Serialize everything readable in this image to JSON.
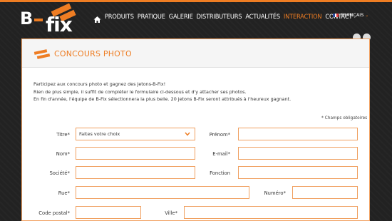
{
  "brand": {
    "logo_b": "B",
    "logo_fix": "fix",
    "accent": "#ee7d23"
  },
  "nav": {
    "items": [
      "PRODUITS",
      "PRATIQUE",
      "GALERIE",
      "DISTRIBUTEURS",
      "ACTUALITÉS",
      "INTERACTION",
      "CONTACT"
    ],
    "active": "INTERACTION"
  },
  "lang": {
    "label": "FRANÇAIS"
  },
  "panel": {
    "title": "CONCOURS PHOTO",
    "intro": [
      "Participez aux concours photo et gagnez des Jetons-B-Fix!",
      "Rien de plus simple, il suffit de compléter le formulaire ci-dessous et d'y attacher ses photos.",
      "En fin d'année, l'équipe de B-Fix sélectionnera la plus belle. 20 jetons B-Fix seront attribués à l'heureux gagnant."
    ],
    "required_note": "* Champs obligatoires"
  },
  "form": {
    "titre_label": "Titre*",
    "titre_value": "Faites votre choix",
    "prenom_label": "Prénom*",
    "nom_label": "Nom*",
    "email_label": "E-mail*",
    "societe_label": "Société*",
    "fonction_label": "Fonction",
    "rue_label": "Rue*",
    "numero_label": "Numéro*",
    "code_postal_label": "Code postal*",
    "ville_label": "Ville*"
  }
}
